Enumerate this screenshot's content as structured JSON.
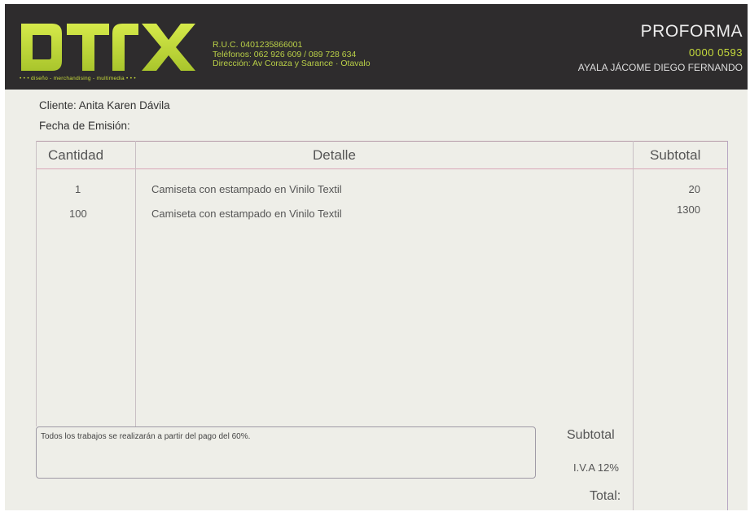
{
  "brand": {
    "logo_text": "DTX",
    "tagline": "• • •  diseño - merchandising - multimedia  • • •"
  },
  "company": {
    "ruc": "R.U.C. 0401235866001",
    "phones": "Teléfonos: 062 926 609 / 089 728 634",
    "address": "Dirección: Av Coraza y Sarance · Otavalo"
  },
  "document": {
    "title": "PROFORMA",
    "number": "0000 0593",
    "owner": "AYALA JÁCOME DIEGO FERNANDO"
  },
  "client": {
    "name_line": "Cliente: Anita Karen Dávila",
    "date_line": "Fecha de Emisión:"
  },
  "table": {
    "headers": {
      "quantity": "Cantidad",
      "detail": "Detalle",
      "subtotal": "Subtotal"
    },
    "rows": [
      {
        "quantity": "1",
        "detail": "Camiseta con estampado en Vinilo Textil",
        "subtotal": "20"
      },
      {
        "quantity": "100",
        "detail": "Camiseta con estampado en Vinilo Textil",
        "subtotal": "1300"
      }
    ]
  },
  "note": "Todos los trabajos se realizarán a partir del pago del 60%.",
  "totals": {
    "subtotal_label": "Subtotal",
    "iva_label": "I.V.A  12%",
    "total_label": "Total:"
  },
  "colors": {
    "header_bg": "#2e2c2d",
    "accent_green": "#bfd63a",
    "paper": "#eeeee8",
    "rule_pink": "#d9a8b8"
  }
}
